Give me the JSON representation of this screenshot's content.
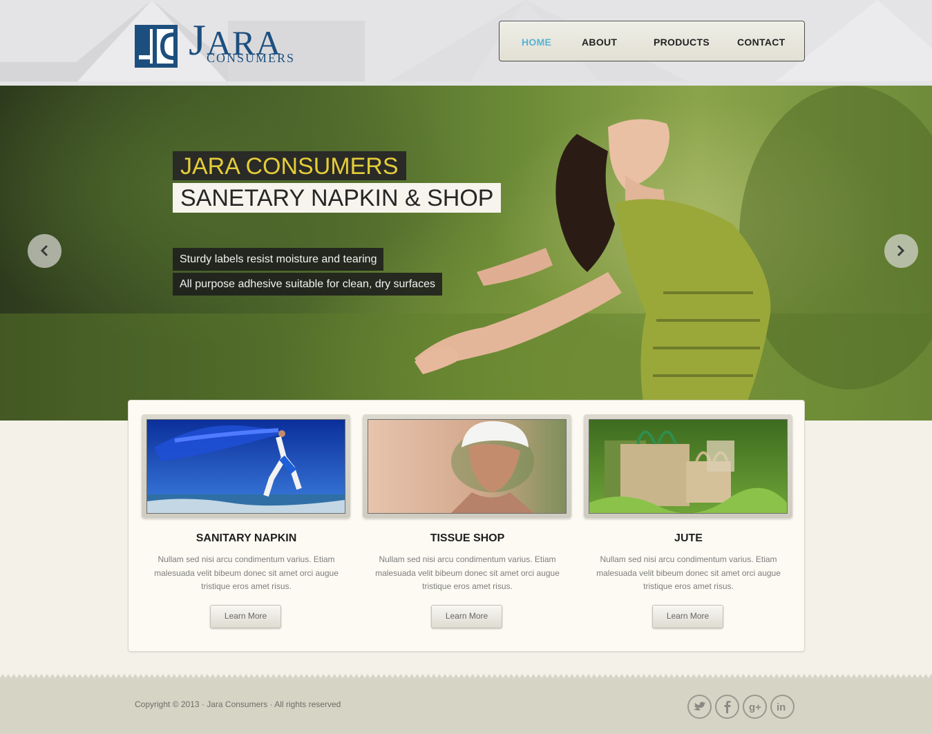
{
  "brand": {
    "name_big": "J",
    "name_rest": "ARA",
    "name_sub": "CONSUMERS",
    "navy": "#1d4f7e"
  },
  "nav": {
    "items": [
      {
        "label": "HOME",
        "active": true
      },
      {
        "label": "ABOUT",
        "active": false
      },
      {
        "label": "PRODUCTS",
        "active": false
      },
      {
        "label": "CONTACT",
        "active": false
      }
    ],
    "active_color": "#55b4d6"
  },
  "hero": {
    "title": "JARA CONSUMERS",
    "subtitle": "SANETARY NAPKIN & SHOP",
    "lines": [
      "Sturdy labels resist moisture and tearing",
      "All purpose adhesive suitable for clean, dry surfaces"
    ],
    "prev_icon": "chevron-left-icon",
    "next_icon": "chevron-right-icon",
    "title_color": "#e4cd3a"
  },
  "cards": [
    {
      "title": "SANITARY NAPKIN",
      "text": "Nullam sed nisi arcu condimentum varius. Etiam malesuada velit bibeum donec sit amet orci augue tristique eros amet risus.",
      "button": "Learn More"
    },
    {
      "title": "TISSUE SHOP",
      "text": "Nullam sed nisi arcu condimentum varius. Etiam malesuada velit bibeum donec sit amet orci augue tristique eros amet risus.",
      "button": "Learn More"
    },
    {
      "title": "JUTE",
      "text": "Nullam sed nisi arcu condimentum varius. Etiam malesuada velit bibeum donec sit amet orci augue tristique eros amet risus.",
      "button": "Learn More"
    }
  ],
  "footer": {
    "copyright": "Copyright © 2013 · Jara Consumers · All rights reserved",
    "social": [
      "twitter-icon",
      "facebook-icon",
      "google-plus-icon",
      "linkedin-icon"
    ]
  }
}
